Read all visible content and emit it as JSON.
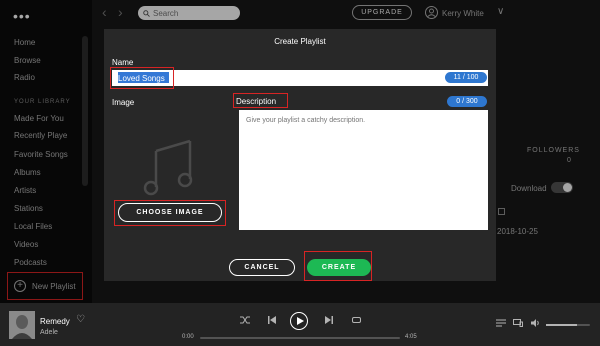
{
  "sidebar": {
    "menu_glyph": "•••",
    "nav": [
      {
        "label": "Home"
      },
      {
        "label": "Browse"
      },
      {
        "label": "Radio"
      }
    ],
    "library_heading": "YOUR LIBRARY",
    "library": [
      {
        "label": "Made For You"
      },
      {
        "label": "Recently Playe"
      },
      {
        "label": "Favorite Songs"
      },
      {
        "label": "Albums"
      },
      {
        "label": "Artists"
      },
      {
        "label": "Stations"
      },
      {
        "label": "Local Files"
      },
      {
        "label": "Videos"
      },
      {
        "label": "Podcasts"
      }
    ],
    "new_playlist_label": "New Playlist"
  },
  "topbar": {
    "back_glyph": "‹",
    "forward_glyph": "›",
    "search_placeholder": "Search",
    "upgrade_label": "UPGRADE",
    "user_name": "Kerry White",
    "chevron_glyph": "∨"
  },
  "background": {
    "followers_label": "FOLLOWERS",
    "followers_count": "0",
    "download_label": "Download",
    "date": "2018-10-25"
  },
  "modal": {
    "title": "Create Playlist",
    "name_label": "Name",
    "name_value": "Loved Songs",
    "name_counter": "11 / 100",
    "image_label": "Image",
    "description_label": "Description",
    "description_counter": "0 / 300",
    "description_placeholder": "Give your playlist a catchy description.",
    "choose_image_label": "CHOOSE IMAGE",
    "cancel_label": "CANCEL",
    "create_label": "CREATE"
  },
  "player": {
    "track_title": "Remedy",
    "artist": "Adele",
    "time_start": "0:00",
    "time_end": "4:05",
    "progress": 0,
    "volume": 0.7,
    "icons": [
      "heart-icon",
      "shuffle-icon",
      "previous-icon",
      "play-icon",
      "next-icon",
      "repeat-icon",
      "queue-icon",
      "devices-icon",
      "volume-icon"
    ]
  },
  "colors": {
    "accent_green": "#1db954",
    "counter_blue": "#2e77d0",
    "highlight_red": "#d72424"
  }
}
